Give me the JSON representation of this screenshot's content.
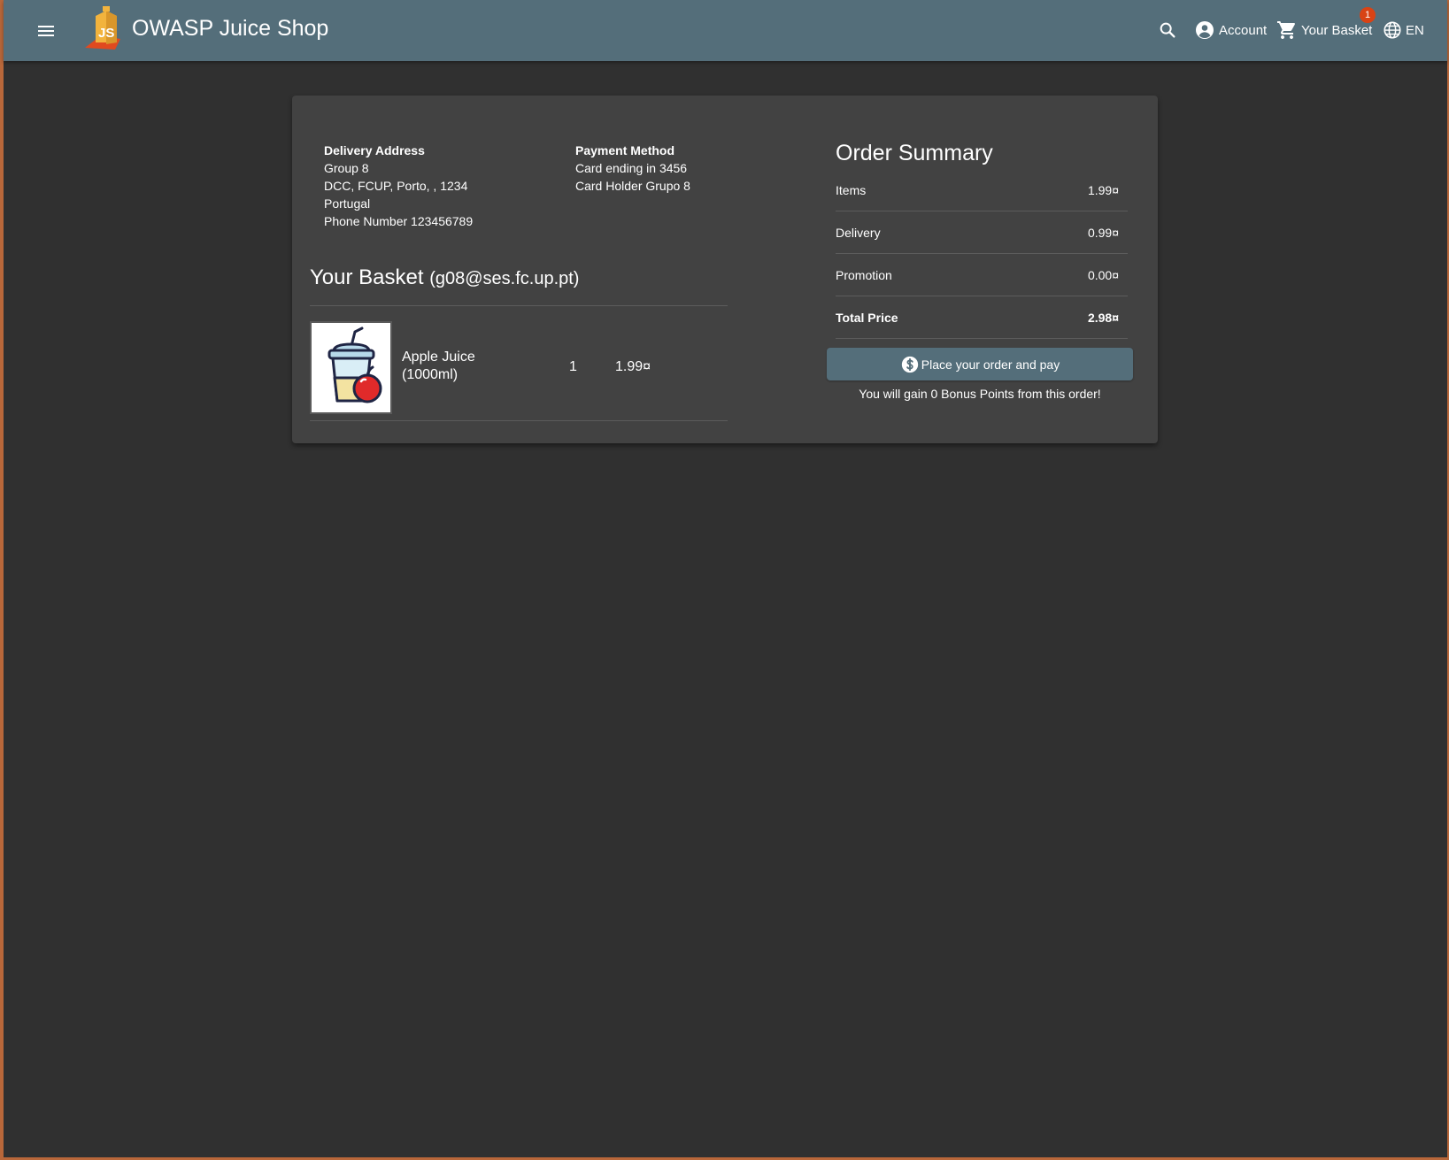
{
  "header": {
    "app_title": "OWASP Juice Shop",
    "logo_text": "JS",
    "account_label": "Account",
    "basket_label": "Your Basket",
    "basket_count": "1",
    "language_label": "EN",
    "colors": {
      "toolbar": "#546e7a",
      "badge": "#d84315"
    },
    "icons": [
      "menu-icon",
      "search-icon",
      "account-circle-icon",
      "shopping-cart-icon",
      "language-icon"
    ]
  },
  "delivery": {
    "heading": "Delivery Address",
    "name": "Group 8",
    "address": "DCC, FCUP, Porto, , 1234",
    "country": "Portugal",
    "phone": "Phone Number 123456789"
  },
  "payment": {
    "heading": "Payment Method",
    "card_ending": "Card ending in 3456",
    "card_holder": "Card Holder Grupo 8"
  },
  "basket": {
    "title": "Your Basket",
    "email": "(g08@ses.fc.up.pt)",
    "items": [
      {
        "name": "Apple Juice (1000ml)",
        "quantity": "1",
        "price": "1.99¤"
      }
    ]
  },
  "summary": {
    "title": "Order Summary",
    "rows": [
      {
        "label": "Items",
        "value": "1.99¤"
      },
      {
        "label": "Delivery",
        "value": "0.99¤"
      },
      {
        "label": "Promotion",
        "value": "0.00¤"
      },
      {
        "label": "Total Price",
        "value": "2.98¤"
      }
    ],
    "place_order_label": "Place your order and pay",
    "bonus_text": "You will gain 0 Bonus Points from this order!"
  }
}
